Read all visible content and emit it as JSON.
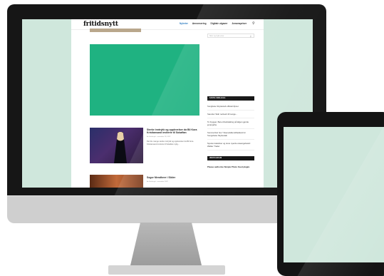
{
  "site": {
    "logo": "fritidsnytt",
    "nav": [
      "Nyheter",
      "Annonsering",
      "Digitale utgaver",
      "Annonspriser"
    ],
    "search_placeholder": "Skriv og trykk enter",
    "posts": [
      {
        "title": "Sterke inntrykk og opplevelser da Bli Kora Kristiansand inviterte til Sokaftan",
        "meta": "Av Fritidsnytt · november 28, 2022",
        "excerpt": "Det ble mange sterke inntrykk og opplevelser da Bli Kora Kristiansand inviterte til Sokaftan nylig..."
      },
      {
        "title": "Segor Mendheer i Sibler",
        "meta": "Av Fritidsnytt · november 2022"
      }
    ],
    "sidebar": {
      "widget_latest": "SISTE INNLEGG",
      "latest_posts": [
        "Songbeke Skyttestab offisielt åpnet",
        "Saunder Skär nettverk till Lange...",
        "To brygger, Bare Ahusbakking på lølgen gjorde jentergribe",
        "Sommerfest hos Ynkenefellsmidtbelland for Songebeke Skyttestab",
        "Nyeste kolektiver og store nyerde anaungebesid: Walker Trader"
      ],
      "widget_instagram": "INSTAGRAM",
      "instagram_text": "Please authorize Simple Photo Feed plugin."
    }
  }
}
